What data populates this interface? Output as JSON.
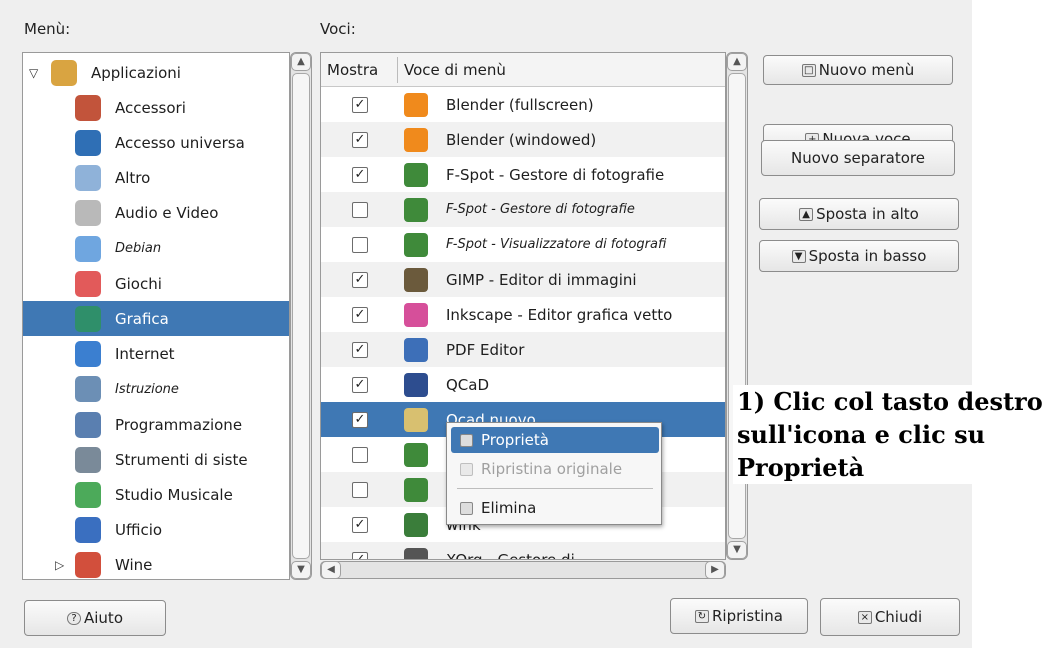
{
  "labels": {
    "menu": "Menù:",
    "items": "Voci:"
  },
  "tree": [
    {
      "label": "Applicazioni",
      "icon": "folder-icon",
      "italic": false,
      "selected": false,
      "expanded": true
    },
    {
      "label": "Accessori",
      "icon": "accessories-icon",
      "italic": false,
      "selected": false
    },
    {
      "label": "Accesso universa",
      "icon": "accessibility-icon",
      "italic": false,
      "selected": false
    },
    {
      "label": "Altro",
      "icon": "other-icon",
      "italic": false,
      "selected": false
    },
    {
      "label": "Audio e Video",
      "icon": "multimedia-icon",
      "italic": false,
      "selected": false
    },
    {
      "label": "Debian",
      "icon": "debian-folder-icon",
      "italic": true,
      "selected": false
    },
    {
      "label": "Giochi",
      "icon": "games-icon",
      "italic": false,
      "selected": false
    },
    {
      "label": "Grafica",
      "icon": "graphics-icon",
      "italic": false,
      "selected": true
    },
    {
      "label": "Internet",
      "icon": "internet-icon",
      "italic": false,
      "selected": false
    },
    {
      "label": "Istruzione",
      "icon": "education-icon",
      "italic": true,
      "selected": false
    },
    {
      "label": "Programmazione",
      "icon": "development-icon",
      "italic": false,
      "selected": false
    },
    {
      "label": "Strumenti di siste",
      "icon": "system-tools-icon",
      "italic": false,
      "selected": false
    },
    {
      "label": "Studio Musicale",
      "icon": "music-icon",
      "italic": false,
      "selected": false
    },
    {
      "label": "Ufficio",
      "icon": "office-icon",
      "italic": false,
      "selected": false
    },
    {
      "label": "Wine",
      "icon": "wine-icon",
      "italic": false,
      "selected": false,
      "expanded": false
    }
  ],
  "table": {
    "col_show": "Mostra",
    "col_item": "Voce di menù",
    "rows": [
      {
        "checked": true,
        "label": "Blender (fullscreen)",
        "italic": false,
        "icon": "blender-icon"
      },
      {
        "checked": true,
        "label": "Blender (windowed)",
        "italic": false,
        "icon": "blender-icon"
      },
      {
        "checked": true,
        "label": "F-Spot - Gestore di fotografie",
        "italic": false,
        "icon": "fspot-icon"
      },
      {
        "checked": false,
        "label": "F-Spot - Gestore di fotografie",
        "italic": true,
        "icon": "fspot-icon"
      },
      {
        "checked": false,
        "label": "F-Spot - Visualizzatore di fotografi",
        "italic": true,
        "icon": "fspot-icon"
      },
      {
        "checked": true,
        "label": "GIMP - Editor di immagini",
        "italic": false,
        "icon": "gimp-icon"
      },
      {
        "checked": true,
        "label": "Inkscape - Editor grafica vetto",
        "italic": false,
        "icon": "inkscape-icon"
      },
      {
        "checked": true,
        "label": "PDF Editor",
        "italic": false,
        "icon": "pdf-editor-icon"
      },
      {
        "checked": true,
        "label": "QCaD",
        "italic": false,
        "icon": "qcad-icon"
      },
      {
        "checked": true,
        "label": "Qcad nuovo",
        "italic": false,
        "icon": "qcad-new-icon",
        "selected": true
      },
      {
        "checked": false,
        "label": "",
        "italic": false,
        "icon": "fspot-icon"
      },
      {
        "checked": false,
        "label": "",
        "italic": false,
        "icon": "fspot-icon"
      },
      {
        "checked": true,
        "label": "wink",
        "italic": false,
        "icon": "wink-icon"
      },
      {
        "checked": true,
        "label": "XOrg - Gestore di ...",
        "italic": false,
        "icon": "xorg-icon"
      }
    ]
  },
  "buttons": {
    "new_menu": "Nuovo menù",
    "new_item": "Nuova voce",
    "new_separator": "Nuovo separatore",
    "move_up": "Sposta in alto",
    "move_down": "Sposta in basso",
    "help": "Aiuto",
    "restore": "Ripristina",
    "close": "Chiudi"
  },
  "context_menu": {
    "properties": "Proprietà",
    "restore_original": "Ripristina originale",
    "delete": "Elimina"
  },
  "annotation": {
    "line1": "1) Clic col tasto destro",
    "line2": "sull'icona e clic su",
    "line3": "Proprietà"
  },
  "colors": {
    "selection": "#3f78b4",
    "window_bg": "#efefef"
  }
}
